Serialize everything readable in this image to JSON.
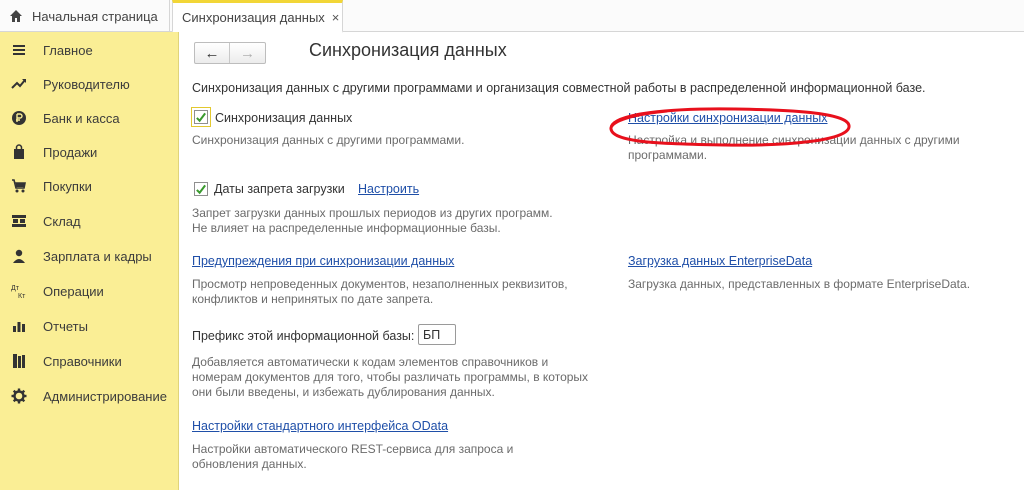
{
  "tabs": {
    "home_label": "Начальная страница",
    "active_label": "Синхронизация данных",
    "close_glyph": "×"
  },
  "sidebar": {
    "items": [
      {
        "label": "Главное",
        "icon": "menu-icon"
      },
      {
        "label": "Руководителю",
        "icon": "trend-icon"
      },
      {
        "label": "Банк и касса",
        "icon": "ruble-icon"
      },
      {
        "label": "Продажи",
        "icon": "bag-icon"
      },
      {
        "label": "Покупки",
        "icon": "cart-icon"
      },
      {
        "label": "Склад",
        "icon": "warehouse-icon"
      },
      {
        "label": "Зарплата и кадры",
        "icon": "person-icon"
      },
      {
        "label": "Операции",
        "icon": "dt-kt-icon"
      },
      {
        "label": "Отчеты",
        "icon": "bar-chart-icon"
      },
      {
        "label": "Справочники",
        "icon": "books-icon"
      },
      {
        "label": "Администрирование",
        "icon": "gear-icon"
      }
    ],
    "dt_text": "Дт",
    "kt_text": "Кт"
  },
  "header": {
    "back_glyph": "←",
    "forward_glyph": "→",
    "title": "Синхронизация данных",
    "description": "Синхронизация данных с другими программами и организация совместной работы в распределенной информационной базе."
  },
  "sync": {
    "checkbox_label": "Синхронизация данных",
    "checked": true,
    "hint": "Синхронизация данных с другими программами.",
    "settings_link": "Настройки синхронизации данных",
    "settings_hint_line1": "Настройка и выполнение синхронизации данных с другими",
    "settings_hint_line2": "программами."
  },
  "lock_dates": {
    "checkbox_label": "Даты запрета загрузки",
    "checked": true,
    "configure_link": "Настроить",
    "hint_line1": "Запрет загрузки данных прошлых периодов из других программ.",
    "hint_line2": "Не влияет на распределенные информационные базы."
  },
  "warnings": {
    "link": "Предупреждения при синхронизации данных",
    "hint_line1": "Просмотр непроведенных документов, незаполненных реквизитов,",
    "hint_line2": "конфликтов и непринятых по дате запрета."
  },
  "enterprise_data": {
    "link": "Загрузка данных EnterpriseData",
    "hint": "Загрузка данных, представленных в формате EnterpriseData."
  },
  "prefix": {
    "label": "Префикс этой информационной базы:",
    "value": "БП",
    "hint_line1": "Добавляется автоматически к кодам элементов справочников и",
    "hint_line2": "номерам документов для того, чтобы различать программы, в которых",
    "hint_line3": "они были введены, и избежать дублирования данных."
  },
  "odata": {
    "link": "Настройки стандартного интерфейса OData",
    "hint_line1": "Настройки автоматического REST-сервиса для запроса и",
    "hint_line2": "обновления данных."
  },
  "colors": {
    "sidebar_bg": "#faee95",
    "link": "#1f4fa8",
    "check_green": "#3a9a2e",
    "annotation_red": "#e8101c",
    "active_tab_accent": "#f2d637"
  }
}
